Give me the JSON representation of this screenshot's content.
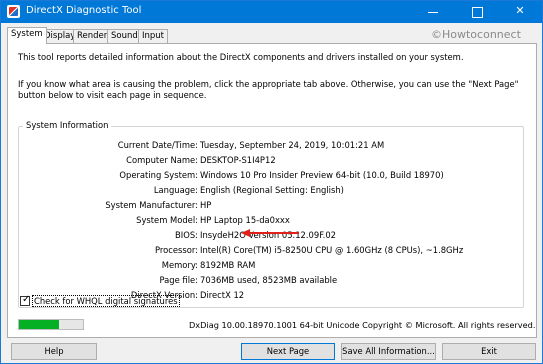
{
  "window": {
    "title": "DirectX Diagnostic Tool",
    "watermark": "©Howtoconnect"
  },
  "tabs": [
    {
      "label": "System",
      "active": true
    },
    {
      "label": "Display",
      "active": false
    },
    {
      "label": "Render",
      "active": false
    },
    {
      "label": "Sound",
      "active": false
    },
    {
      "label": "Input",
      "active": false
    }
  ],
  "intro": {
    "line1": "This tool reports detailed information about the DirectX components and drivers installed on your system.",
    "line2": "If you know what area is causing the problem, click the appropriate tab above.  Otherwise, you can use the \"Next Page\" button below to visit each page in sequence."
  },
  "system_information": {
    "title": "System Information",
    "rows": [
      {
        "label": "Current Date/Time:",
        "value": "Tuesday, September 24, 2019, 10:01:21 AM"
      },
      {
        "label": "Computer Name:",
        "value": "DESKTOP-S1I4P12"
      },
      {
        "label": "Operating System:",
        "value": "Windows 10 Pro Insider Preview 64-bit (10.0, Build 18970)"
      },
      {
        "label": "Language:",
        "value": "English (Regional Setting: English)"
      },
      {
        "label": "System Manufacturer:",
        "value": "HP"
      },
      {
        "label": "System Model:",
        "value": "HP Laptop 15-da0xxx"
      },
      {
        "label": "BIOS:",
        "value": "InsydeH2O Version 05.12.09F.02"
      },
      {
        "label": "Processor:",
        "value": "Intel(R) Core(TM) i5-8250U CPU @ 1.60GHz (8 CPUs), ~1.8GHz"
      },
      {
        "label": "Memory:",
        "value": "8192MB RAM"
      },
      {
        "label": "Page file:",
        "value": "7036MB used, 8523MB available"
      },
      {
        "label": "DirectX Version:",
        "value": "DirectX 12"
      }
    ]
  },
  "whql": {
    "label": "Check for WHQL digital signatures",
    "checked": true
  },
  "progress": {
    "fraction": 0.62,
    "color": "#06b025"
  },
  "footer_info": "DxDiag 10.00.18970.1001 64-bit Unicode  Copyright © Microsoft. All rights reserved.",
  "buttons": {
    "help": "Help",
    "next_page": "Next Page",
    "save_all": "Save All Information...",
    "exit": "Exit"
  },
  "colors": {
    "titlebar": "#0078d7",
    "arrow": "#e0201b"
  }
}
